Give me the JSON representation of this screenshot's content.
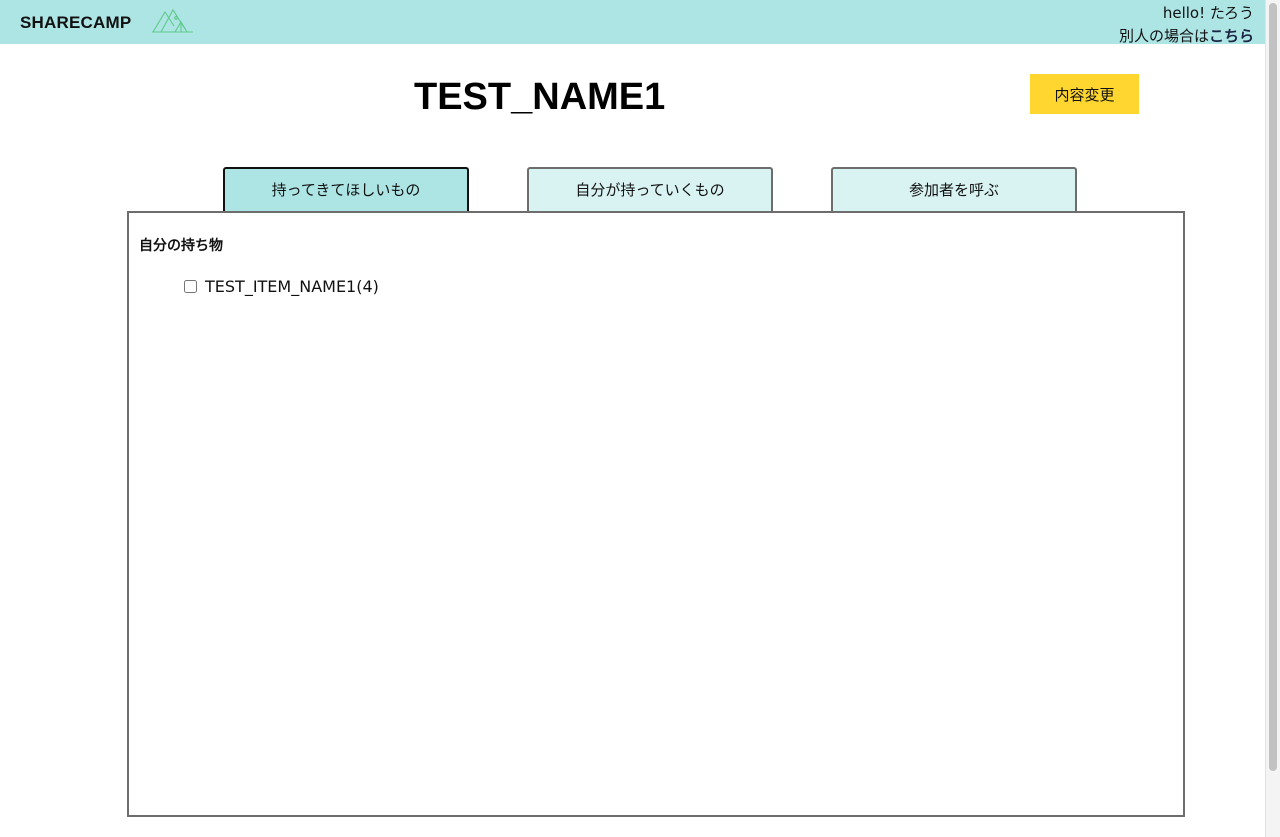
{
  "header": {
    "brand": "SHARECAMP",
    "logo_icon": "mountain-tent-icon",
    "greeting": "hello! たろう",
    "switch_prefix": "別人の場合は",
    "switch_link": "こちら",
    "background_color": "#ade5e5"
  },
  "event": {
    "title": "TEST_NAME1",
    "edit_button": "内容変更",
    "edit_button_color": "#ffd530"
  },
  "tabs": [
    {
      "label": "持ってきてほしいもの",
      "active": true
    },
    {
      "label": "自分が持っていくもの",
      "active": false
    },
    {
      "label": "参加者を呼ぶ",
      "active": false
    }
  ],
  "panel": {
    "heading": "自分の持ち物",
    "items": [
      {
        "name": "TEST_ITEM_NAME1",
        "count": "(4)",
        "checked": false
      }
    ]
  }
}
